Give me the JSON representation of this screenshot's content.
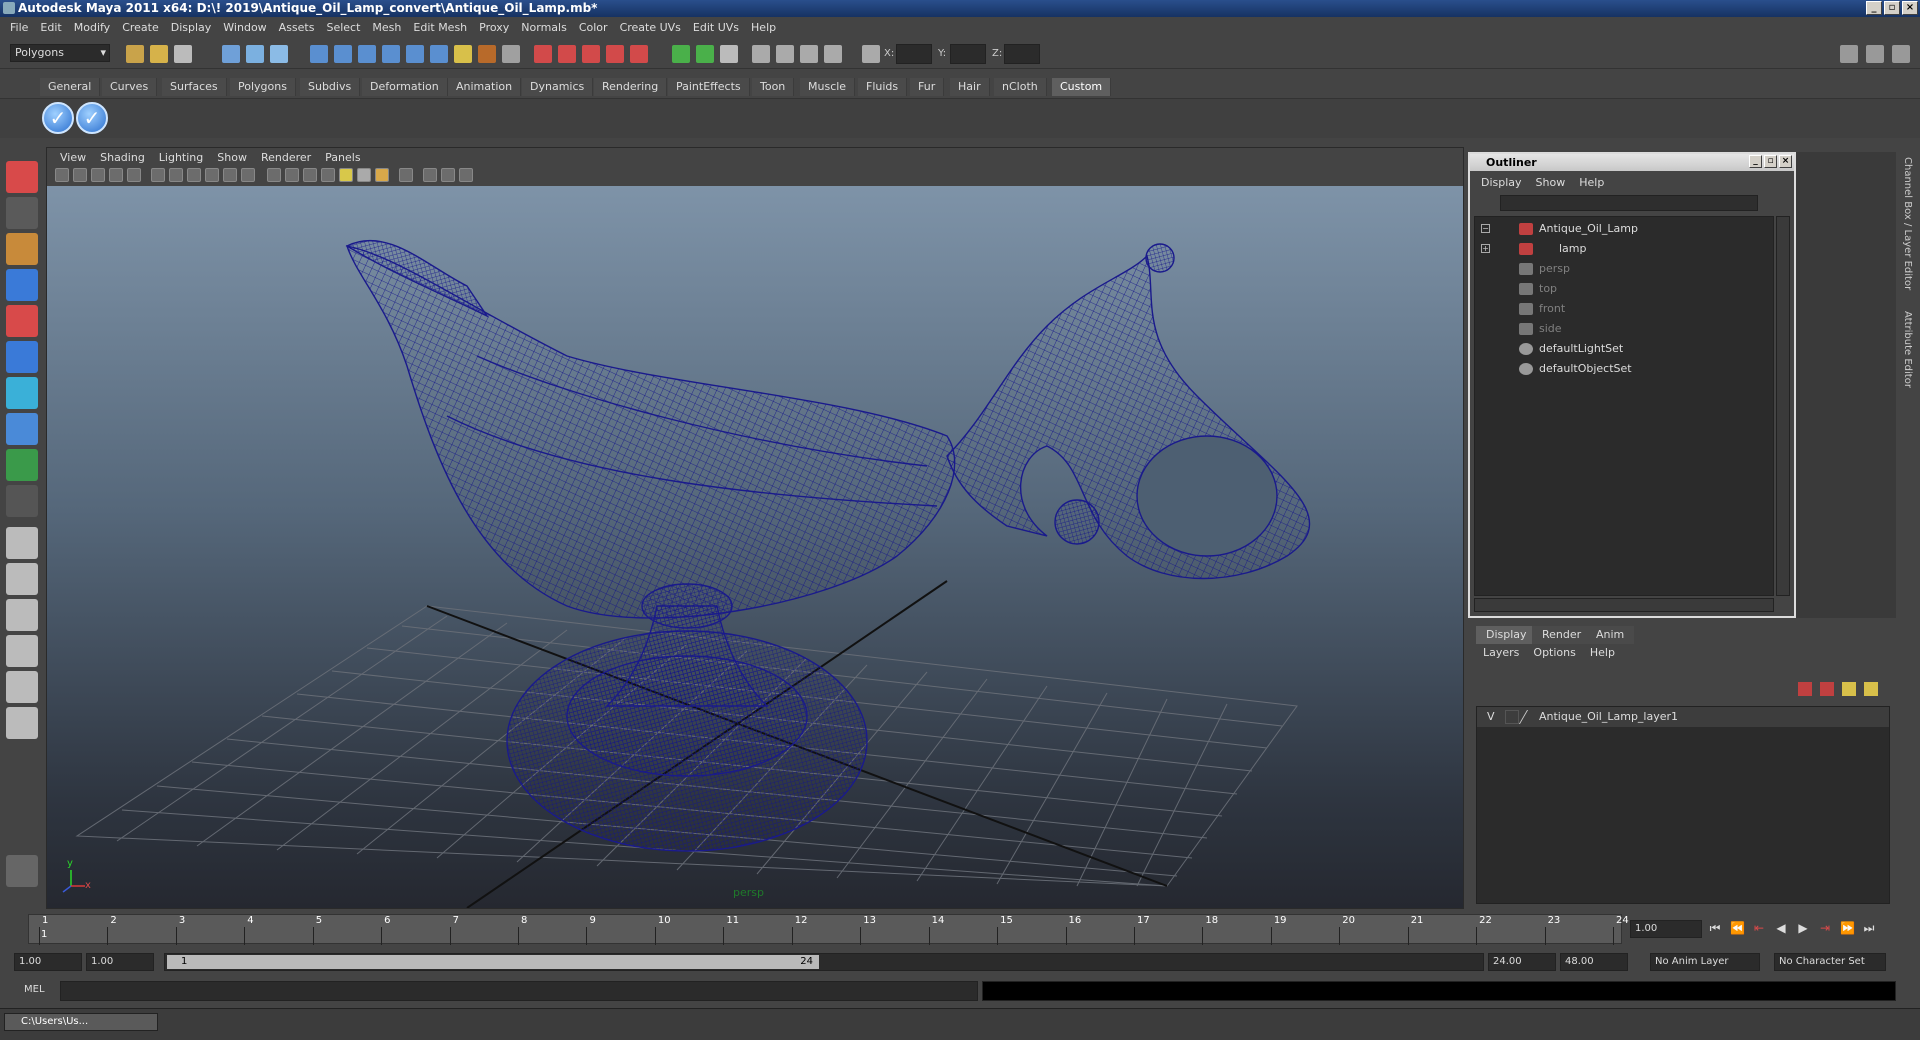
{
  "window": {
    "title": "Autodesk Maya 2011 x64: D:\\! 2019\\Antique_Oil_Lamp_convert\\Antique_Oil_Lamp.mb*"
  },
  "menubar": [
    "File",
    "Edit",
    "Modify",
    "Create",
    "Display",
    "Window",
    "Assets",
    "Select",
    "Mesh",
    "Edit Mesh",
    "Proxy",
    "Normals",
    "Color",
    "Create UVs",
    "Edit UVs",
    "Help"
  ],
  "statusline": {
    "mode": "Polygons",
    "x_label": "X:",
    "y_label": "Y:",
    "z_label": "Z:"
  },
  "shelf_tabs": [
    "General",
    "Curves",
    "Surfaces",
    "Polygons",
    "Subdivs",
    "Deformation",
    "Animation",
    "Dynamics",
    "Rendering",
    "PaintEffects",
    "Toon",
    "Muscle",
    "Fluids",
    "Fur",
    "Hair",
    "nCloth",
    "Custom"
  ],
  "shelf_active": "Custom",
  "viewport": {
    "menus": [
      "View",
      "Shading",
      "Lighting",
      "Show",
      "Renderer",
      "Panels"
    ],
    "camera_label": "persp",
    "axis_x": "x",
    "axis_y": "y"
  },
  "outliner": {
    "title": "Outliner",
    "menus": [
      "Display",
      "Show",
      "Help"
    ],
    "items": [
      {
        "label": "Antique_Oil_Lamp",
        "expander": "−",
        "dim": false
      },
      {
        "label": "lamp",
        "expander": "+",
        "dim": false
      },
      {
        "label": "persp",
        "expander": "",
        "dim": true
      },
      {
        "label": "top",
        "expander": "",
        "dim": true
      },
      {
        "label": "front",
        "expander": "",
        "dim": true
      },
      {
        "label": "side",
        "expander": "",
        "dim": true
      },
      {
        "label": "defaultLightSet",
        "expander": "",
        "dim": false
      },
      {
        "label": "defaultObjectSet",
        "expander": "",
        "dim": false
      }
    ]
  },
  "layer_editor": {
    "tabs": [
      "Display",
      "Render",
      "Anim"
    ],
    "active_tab": "Display",
    "menus": [
      "Layers",
      "Options",
      "Help"
    ],
    "layer": {
      "visibility": "V",
      "name": "Antique_Oil_Lamp_layer1"
    }
  },
  "side_tabs": [
    "Channel Box / Layer Editor",
    "Attribute Editor"
  ],
  "timeline": {
    "ticks": [
      "1",
      "2",
      "3",
      "4",
      "5",
      "6",
      "7",
      "8",
      "9",
      "10",
      "11",
      "12",
      "13",
      "14",
      "15",
      "16",
      "17",
      "18",
      "19",
      "20",
      "21",
      "22",
      "23",
      "24"
    ],
    "current_frame_marker": "1",
    "current_frame": "1.00"
  },
  "range": {
    "start": "1.00",
    "inner_start": "1.00",
    "handle_start": "1",
    "handle_end": "24",
    "end": "24.00",
    "outer_end": "48.00",
    "anim_layer": "No Anim Layer",
    "character_set": "No Character Set"
  },
  "cmdline": {
    "label": "MEL"
  },
  "taskbar": {
    "item": "C:\\Users\\Us..."
  },
  "colors": {
    "wire": "#1a1a8c",
    "accent": "#2a4f8c"
  }
}
